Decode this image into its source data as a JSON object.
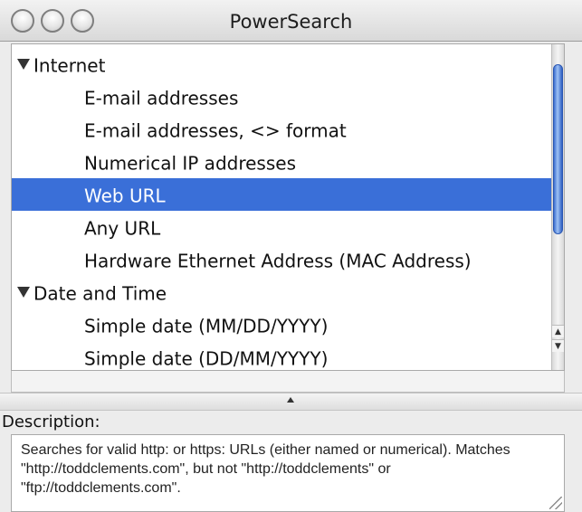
{
  "window": {
    "title": "PowerSearch"
  },
  "list": {
    "rows": [
      {
        "label": "Internet",
        "kind": "group",
        "expanded": true
      },
      {
        "label": "E-mail addresses",
        "kind": "child"
      },
      {
        "label": "E-mail addresses, <> format",
        "kind": "child"
      },
      {
        "label": "Numerical IP addresses",
        "kind": "child"
      },
      {
        "label": "Web URL",
        "kind": "child",
        "selected": true
      },
      {
        "label": "Any URL",
        "kind": "child"
      },
      {
        "label": "Hardware Ethernet Address (MAC Address)",
        "kind": "child"
      },
      {
        "label": "Date and Time",
        "kind": "group",
        "expanded": true
      },
      {
        "label": "Simple date (MM/DD/YYYY)",
        "kind": "child"
      },
      {
        "label": "Simple date (DD/MM/YYYY)",
        "kind": "child"
      }
    ],
    "selected_color": "#3a6fd8"
  },
  "description": {
    "label": "Description:",
    "text": "Searches for valid http: or https: URLs (either named or numerical). Matches \"http://toddclements.com\", but not \"http://toddclements\" or \"ftp://toddclements.com\"."
  },
  "icons": {
    "disclosure": "disclosure-triangle-down-icon",
    "splitter": "splitter-grip-icon",
    "resize": "resize-grip-icon"
  }
}
